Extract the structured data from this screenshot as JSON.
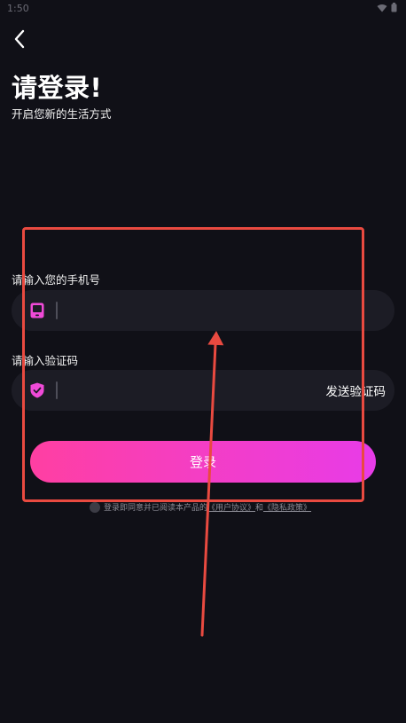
{
  "status_bar": {
    "time": "1:50",
    "icons": [
      "wifi-icon",
      "battery-icon"
    ]
  },
  "header": {
    "back_icon": "chevron-left-icon",
    "title": "请登录!",
    "subtitle": "开启您新的生活方式"
  },
  "phone": {
    "label": "请输入您的手机号",
    "value": "",
    "placeholder": "",
    "icon": "phone-icon"
  },
  "code": {
    "label": "请输入验证码",
    "value": "",
    "placeholder": "",
    "icon": "shield-check-icon",
    "send_label": "发送验证码"
  },
  "login": {
    "label": "登录"
  },
  "agreement": {
    "prefix": "登录即同意并已阅读本产品的",
    "user_agreement": "《用户协议》",
    "conjunction": "和",
    "privacy_policy": "《隐私政策》"
  },
  "colors": {
    "background": "#101017",
    "input_bg": "#1c1c25",
    "accent_pink": "#ff3fa2",
    "accent_purple": "#e83ce8",
    "icon_color": "#f04ad8",
    "annotation_red": "#e94a40"
  }
}
